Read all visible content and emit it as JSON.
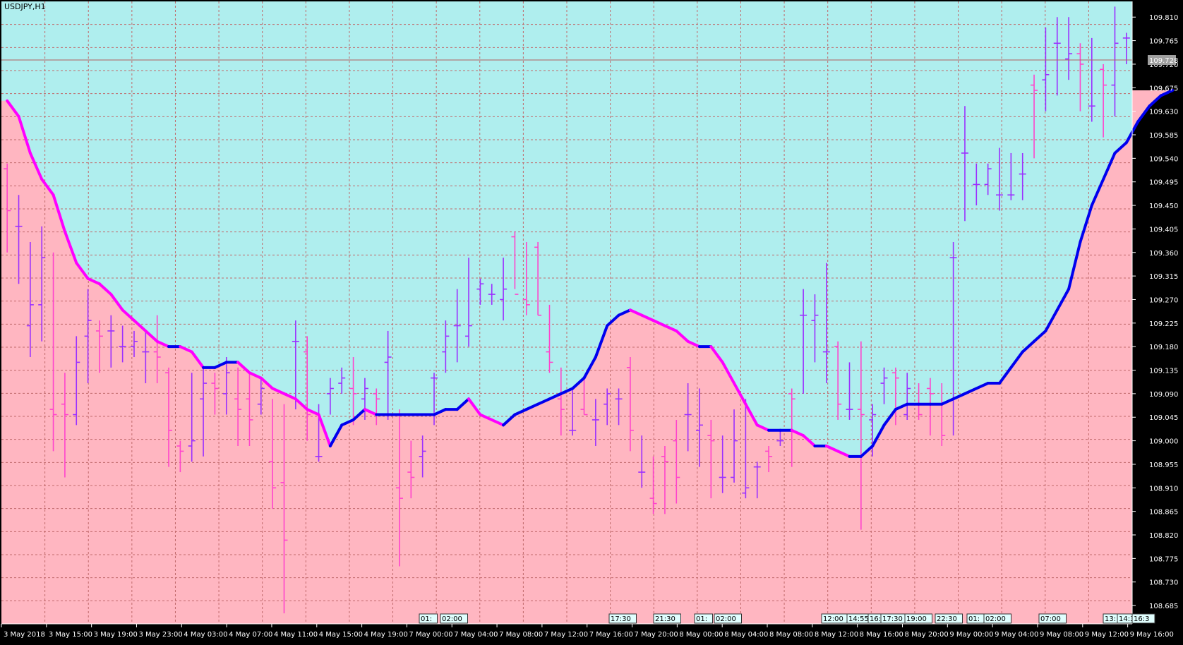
{
  "window": {
    "title": "USDJPY,H1"
  },
  "chart_data": {
    "type": "bar",
    "symbol": "USDJPY,H1",
    "ylim": [
      108.65,
      109.84
    ],
    "current_price": 109.728,
    "y_ticks": [
      "109.810",
      "109.765",
      "109.720",
      "109.675",
      "109.630",
      "109.585",
      "109.540",
      "109.495",
      "109.450",
      "109.405",
      "109.360",
      "109.315",
      "109.270",
      "109.225",
      "109.180",
      "109.135",
      "109.090",
      "109.045",
      "109.000",
      "108.955",
      "108.910",
      "108.865",
      "108.820",
      "108.775",
      "108.730",
      "108.685"
    ],
    "x_ticks": [
      "3 May 2018",
      "3 May 15:00",
      "3 May 19:00",
      "3 May 23:00",
      "4 May 03:00",
      "4 May 07:00",
      "4 May 11:00",
      "4 May 15:00",
      "4 May 19:00",
      "7 May 00:00",
      "7 May 04:00",
      "7 May 08:00",
      "7 May 12:00",
      "7 May 16:00",
      "7 May 20:00",
      "8 May 00:00",
      "8 May 04:00",
      "8 May 08:00",
      "8 May 12:00",
      "8 May 16:00",
      "8 May 20:00",
      "9 May 00:00",
      "9 May 04:00",
      "9 May 08:00",
      "9 May 12:00",
      "9 May 16:00"
    ],
    "event_tags": [
      "01:",
      "02:00",
      "17:30",
      "21:30",
      "01:",
      "02:00",
      "12:00",
      "14:55",
      "16:",
      "17:30",
      "19:00",
      "22:30",
      "01:",
      "02:00",
      "07:00",
      "13:",
      "14:30",
      "16:3"
    ],
    "colors": {
      "up_fill": "#AFEEEE",
      "down_fill": "#FFB6C1",
      "bull": "#9B30FF",
      "bear": "#FF44CC",
      "ma_bull": "#0000EE",
      "ma_bear": "#FF00FF",
      "grid": "#C0696B"
    },
    "series": [
      {
        "type": "ohlc",
        "values": [
          [
            109.52,
            109.53,
            109.36,
            109.44
          ],
          [
            109.41,
            109.47,
            109.3,
            109.41
          ],
          [
            109.22,
            109.38,
            109.16,
            109.26
          ],
          [
            109.26,
            109.41,
            109.19,
            109.35
          ],
          [
            109.06,
            109.36,
            108.98,
            109.05
          ],
          [
            109.07,
            109.13,
            108.93,
            109.05
          ],
          [
            109.05,
            109.2,
            109.03,
            109.15
          ],
          [
            109.2,
            109.29,
            109.11,
            109.23
          ],
          [
            109.21,
            109.23,
            109.13,
            109.2
          ],
          [
            109.21,
            109.24,
            109.14,
            109.21
          ],
          [
            109.18,
            109.22,
            109.15,
            109.18
          ],
          [
            109.18,
            109.21,
            109.16,
            109.19
          ],
          [
            109.17,
            109.21,
            109.11,
            109.17
          ],
          [
            109.17,
            109.24,
            109.11,
            109.16
          ],
          [
            109.13,
            109.14,
            108.95,
            109.02
          ],
          [
            108.99,
            109.0,
            108.94,
            108.98
          ],
          [
            108.99,
            109.13,
            108.96,
            109.0
          ],
          [
            109.08,
            109.14,
            108.97,
            109.11
          ],
          [
            109.11,
            109.13,
            109.05,
            109.1
          ],
          [
            109.09,
            109.16,
            109.05,
            109.13
          ],
          [
            109.08,
            109.14,
            108.99,
            109.06
          ],
          [
            109.08,
            109.13,
            108.99,
            109.04
          ],
          [
            109.07,
            109.12,
            109.05,
            109.1
          ],
          [
            108.96,
            109.08,
            108.87,
            108.91
          ],
          [
            108.92,
            109.07,
            108.67,
            108.81
          ],
          [
            109.19,
            109.23,
            109.06,
            109.19
          ],
          [
            109.17,
            109.2,
            109.0,
            109.05
          ],
          [
            108.97,
            109.07,
            108.96,
            108.97
          ],
          [
            109.09,
            109.12,
            109.05,
            109.1
          ],
          [
            109.11,
            109.14,
            109.09,
            109.12
          ],
          [
            109.1,
            109.16,
            109.03,
            109.09
          ],
          [
            109.08,
            109.12,
            109.04,
            109.1
          ],
          [
            109.09,
            109.1,
            109.03,
            109.08
          ],
          [
            109.15,
            109.21,
            109.04,
            109.16
          ],
          [
            108.91,
            109.06,
            108.76,
            108.89
          ],
          [
            108.94,
            109.0,
            108.89,
            108.93
          ],
          [
            108.97,
            109.01,
            108.93,
            108.98
          ],
          [
            109.12,
            109.13,
            109.03,
            109.12
          ],
          [
            109.17,
            109.23,
            109.13,
            109.2
          ],
          [
            109.22,
            109.29,
            109.15,
            109.22
          ],
          [
            109.2,
            109.35,
            109.18,
            109.22
          ],
          [
            109.29,
            109.31,
            109.26,
            109.3
          ],
          [
            109.28,
            109.3,
            109.26,
            109.28
          ],
          [
            109.27,
            109.35,
            109.23,
            109.29
          ],
          [
            109.39,
            109.4,
            109.29,
            109.28
          ],
          [
            109.27,
            109.38,
            109.24,
            109.26
          ],
          [
            109.37,
            109.38,
            109.24,
            109.24
          ],
          [
            109.17,
            109.26,
            109.13,
            109.15
          ],
          [
            109.08,
            109.14,
            109.01,
            109.06
          ],
          [
            109.02,
            109.1,
            109.01,
            109.02
          ],
          [
            109.06,
            109.12,
            109.05,
            109.05
          ],
          [
            109.04,
            109.08,
            108.99,
            109.04
          ],
          [
            109.07,
            109.1,
            109.03,
            109.09
          ],
          [
            109.08,
            109.1,
            109.03,
            109.08
          ],
          [
            109.14,
            109.16,
            108.98,
            109.02
          ],
          [
            108.94,
            109.01,
            108.91,
            108.94
          ],
          [
            108.89,
            108.97,
            108.86,
            108.88
          ],
          [
            108.97,
            108.99,
            108.86,
            108.96
          ],
          [
            109.0,
            109.04,
            108.88,
            108.93
          ],
          [
            109.05,
            109.11,
            108.98,
            109.05
          ],
          [
            109.02,
            109.1,
            108.95,
            109.03
          ],
          [
            109.01,
            109.04,
            108.89,
            109.0
          ],
          [
            108.93,
            109.01,
            108.9,
            108.93
          ],
          [
            108.93,
            109.06,
            108.92,
            109.0
          ],
          [
            108.9,
            109.08,
            108.89,
            108.91
          ],
          [
            108.95,
            108.96,
            108.89,
            108.95
          ],
          [
            108.98,
            108.99,
            108.94,
            108.97
          ],
          [
            109.0,
            109.02,
            108.99,
            109.0
          ],
          [
            109.09,
            109.1,
            108.95,
            109.08
          ],
          [
            109.24,
            109.29,
            109.09,
            109.24
          ],
          [
            109.23,
            109.28,
            109.15,
            109.24
          ],
          [
            109.17,
            109.34,
            109.11,
            109.17
          ],
          [
            109.18,
            109.19,
            109.04,
            109.07
          ],
          [
            109.06,
            109.15,
            109.04,
            109.06
          ],
          [
            109.06,
            109.19,
            108.83,
            109.05
          ],
          [
            109.04,
            109.07,
            108.97,
            109.05
          ],
          [
            109.11,
            109.14,
            109.07,
            109.12
          ],
          [
            109.13,
            109.14,
            109.03,
            109.12
          ],
          [
            109.05,
            109.13,
            109.04,
            109.1
          ],
          [
            109.07,
            109.11,
            109.04,
            109.05
          ],
          [
            109.1,
            109.12,
            109.01,
            109.09
          ],
          [
            109.07,
            109.11,
            108.99,
            109.01
          ],
          [
            109.35,
            109.38,
            109.01,
            109.35
          ],
          [
            109.55,
            109.64,
            109.42,
            109.55
          ],
          [
            109.49,
            109.53,
            109.45,
            109.49
          ],
          [
            109.49,
            109.53,
            109.47,
            109.52
          ],
          [
            109.47,
            109.56,
            109.44,
            109.47
          ],
          [
            109.47,
            109.55,
            109.46,
            109.47
          ],
          [
            109.51,
            109.55,
            109.46,
            109.51
          ],
          [
            109.68,
            109.7,
            109.54,
            109.67
          ],
          [
            109.69,
            109.79,
            109.63,
            109.7
          ],
          [
            109.76,
            109.81,
            109.66,
            109.76
          ],
          [
            109.73,
            109.81,
            109.69,
            109.74
          ],
          [
            109.74,
            109.76,
            109.63,
            109.72
          ],
          [
            109.64,
            109.77,
            109.61,
            109.64
          ],
          [
            109.71,
            109.72,
            109.58,
            109.68
          ],
          [
            109.68,
            109.83,
            109.62,
            109.76
          ],
          [
            109.77,
            109.78,
            109.72,
            109.77
          ]
        ]
      },
      {
        "type": "ma",
        "values": [
          109.65,
          109.62,
          109.55,
          109.5,
          109.47,
          109.4,
          109.34,
          109.31,
          109.3,
          109.28,
          109.25,
          109.23,
          109.21,
          109.19,
          109.18,
          109.18,
          109.17,
          109.14,
          109.14,
          109.15,
          109.15,
          109.13,
          109.12,
          109.1,
          109.09,
          109.08,
          109.06,
          109.05,
          108.99,
          109.03,
          109.04,
          109.06,
          109.05,
          109.05,
          109.05,
          109.05,
          109.05,
          109.05,
          109.06,
          109.06,
          109.08,
          109.05,
          109.04,
          109.03,
          109.05,
          109.06,
          109.07,
          109.08,
          109.09,
          109.1,
          109.12,
          109.16,
          109.22,
          109.24,
          109.25,
          109.24,
          109.23,
          109.22,
          109.21,
          109.19,
          109.18,
          109.18,
          109.15,
          109.11,
          109.07,
          109.03,
          109.02,
          109.02,
          109.02,
          109.01,
          108.99,
          108.99,
          108.98,
          108.97,
          108.97,
          108.99,
          109.03,
          109.06,
          109.07,
          109.07,
          109.07,
          109.07,
          109.08,
          109.09,
          109.1,
          109.11,
          109.11,
          109.14,
          109.17,
          109.19,
          109.21,
          109.25,
          109.29,
          109.38,
          109.45,
          109.5,
          109.55,
          109.57,
          109.61,
          109.64,
          109.66,
          109.67
        ]
      }
    ]
  }
}
